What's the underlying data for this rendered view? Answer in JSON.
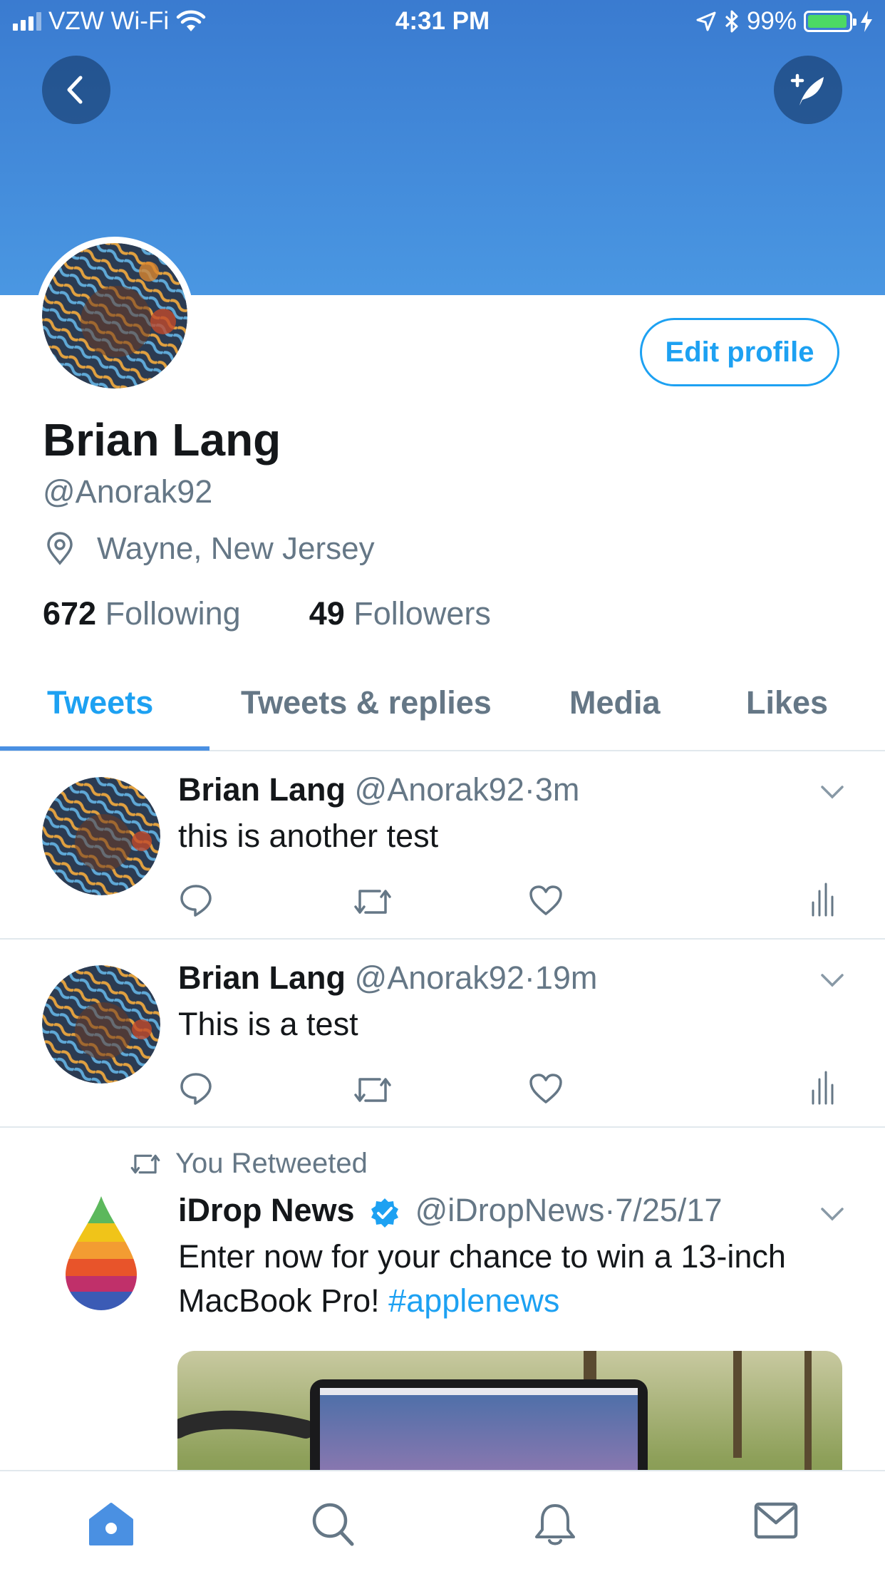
{
  "status_bar": {
    "carrier": "VZW Wi-Fi",
    "time": "4:31 PM",
    "battery": "99%"
  },
  "header": {
    "back_icon": "chevron-left-icon",
    "compose_icon": "compose-tweet-icon"
  },
  "profile": {
    "name": "Brian Lang",
    "handle": "@Anorak92",
    "location": "Wayne, New Jersey",
    "following_count": "672",
    "following_label": "Following",
    "followers_count": "49",
    "followers_label": "Followers",
    "edit_button": "Edit profile"
  },
  "tabs": [
    "Tweets",
    "Tweets & replies",
    "Media",
    "Likes"
  ],
  "tweets": [
    {
      "name": "Brian Lang",
      "handle": "@Anorak92",
      "sep": "·",
      "time": "3m",
      "text": "this is another test"
    },
    {
      "name": "Brian Lang",
      "handle": "@Anorak92",
      "sep": "·",
      "time": "19m",
      "text": "This is a test"
    },
    {
      "retweet_label": "You Retweeted",
      "name": "iDrop News",
      "handle": "@iDropNews",
      "sep": "·",
      "time": "7/25/17",
      "text": "Enter now for your chance to win a 13-inch MacBook Pro!",
      "hashtag": "#applenews"
    }
  ],
  "colors": {
    "accent": "#1da1f2",
    "header_top": "#3a7bd0",
    "header_bottom": "#4a97e2",
    "secondary_text": "#657786"
  },
  "bottom_nav": [
    "home-icon",
    "search-icon",
    "notifications-icon",
    "messages-icon"
  ]
}
